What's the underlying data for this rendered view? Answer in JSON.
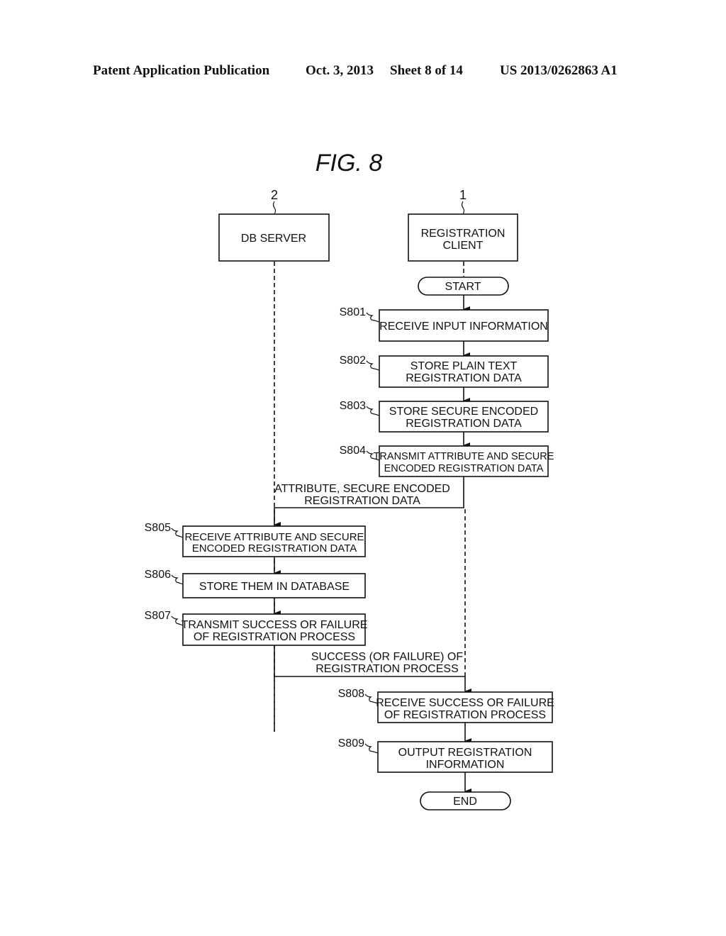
{
  "header": {
    "publication": "Patent Application Publication",
    "date": "Oct. 3, 2013",
    "sheet": "Sheet 8 of 14",
    "number": "US 2013/0262863 A1"
  },
  "figure": {
    "title": "FIG.  8",
    "entities": [
      {
        "ref": "2",
        "label": [
          "DB SERVER"
        ]
      },
      {
        "ref": "1",
        "label": [
          "REGISTRATION",
          "CLIENT"
        ]
      }
    ],
    "terminals": {
      "start": "START",
      "end": "END"
    },
    "steps": [
      {
        "id": "S801",
        "lines": [
          "RECEIVE INPUT INFORMATION"
        ]
      },
      {
        "id": "S802",
        "lines": [
          "STORE PLAIN TEXT",
          "REGISTRATION DATA"
        ]
      },
      {
        "id": "S803",
        "lines": [
          "STORE SECURE ENCODED",
          "REGISTRATION DATA"
        ]
      },
      {
        "id": "S804",
        "lines": [
          "TRANSMIT ATTRIBUTE AND SECURE",
          "ENCODED REGISTRATION DATA"
        ]
      },
      {
        "id": "S805",
        "lines": [
          "RECEIVE ATTRIBUTE AND SECURE",
          "ENCODED REGISTRATION DATA"
        ]
      },
      {
        "id": "S806",
        "lines": [
          "STORE THEM IN DATABASE"
        ]
      },
      {
        "id": "S807",
        "lines": [
          "TRANSMIT SUCCESS OR FAILURE",
          "OF REGISTRATION PROCESS"
        ]
      },
      {
        "id": "S808",
        "lines": [
          "RECEIVE SUCCESS OR FAILURE",
          "OF REGISTRATION PROCESS"
        ]
      },
      {
        "id": "S809",
        "lines": [
          "OUTPUT REGISTRATION",
          "INFORMATION"
        ]
      }
    ],
    "messages": [
      {
        "lines": [
          "ATTRIBUTE, SECURE ENCODED",
          "REGISTRATION DATA"
        ]
      },
      {
        "lines": [
          "SUCCESS (OR FAILURE) OF",
          "REGISTRATION PROCESS"
        ]
      }
    ]
  }
}
